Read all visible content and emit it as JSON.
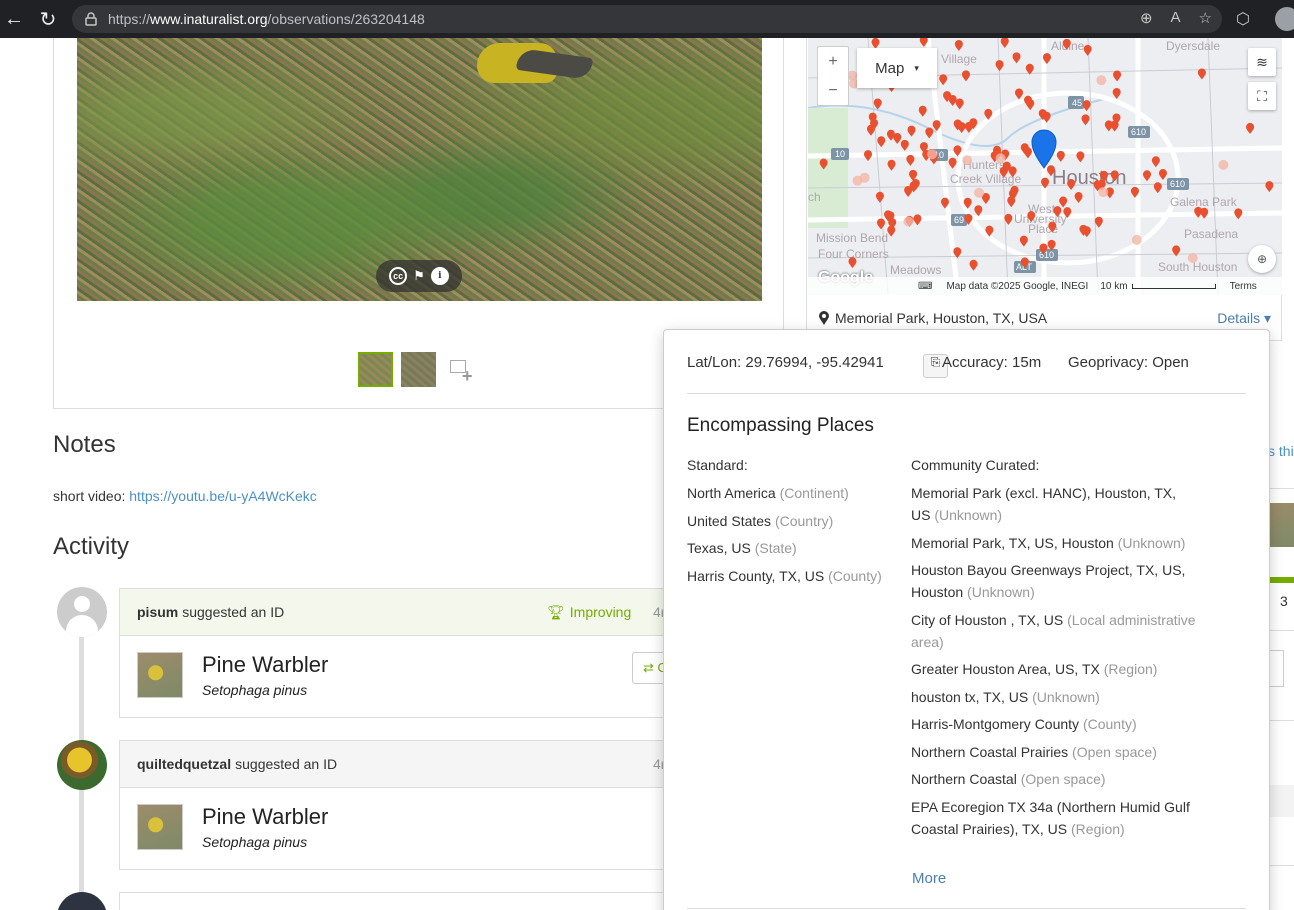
{
  "browser": {
    "url_prefix": "https://",
    "url_domain": "www.inaturalist.org",
    "url_path": "/observations/263204148"
  },
  "photo": {
    "thumbnail_count": 2
  },
  "map": {
    "type_label": "Map",
    "labels": {
      "aldine": "Aldine",
      "dyersdale": "Dyersdale",
      "village": "Village",
      "hunters": "Hunters",
      "creek_village": "Creek Village",
      "houston": "Houston",
      "galena_park": "Galena Park",
      "west": "West",
      "university": "University",
      "place": "Place",
      "mission_bend": "Mission Bend",
      "four_corners": "Four Corners",
      "meadows": "Meadows",
      "pasadena": "Pasadena",
      "south_houston": "South Houston",
      "ch": "ch",
      "hwy_10a": "10",
      "hwy_10b": "10",
      "hwy_45": "45",
      "hwy_610a": "610",
      "hwy_610b": "610",
      "hwy_610c": "610",
      "hwy_69": "69",
      "hwy_alt": "ALT"
    },
    "attribution": "Map data ©2025 Google, INEGI",
    "scale": "10 km",
    "terms": "Terms",
    "google": "Google",
    "place_name": "Memorial Park, Houston, TX, USA",
    "details_label": "Details"
  },
  "notes": {
    "heading": "Notes",
    "text": "short video: ",
    "link": "https://youtu.be/u-yA4WcKekc"
  },
  "activity": {
    "heading": "Activity",
    "items": [
      {
        "user": "pisum",
        "action": "suggested an ID",
        "badge": "Improving",
        "time": "4r",
        "taxon_common": "Pine Warbler",
        "taxon_scientific": "Setophaga pinus",
        "agree": "⇄ C"
      },
      {
        "user": "quiltedquetzal",
        "action": "suggested an ID",
        "time": "4r",
        "taxon_common": "Pine Warbler",
        "taxon_scientific": "Setophaga pinus"
      }
    ]
  },
  "right_column": {
    "fragment_text": "s thi",
    "number": "3"
  },
  "location_popover": {
    "latlon_label": "Lat/Lon: 29.76994, -95.42941",
    "accuracy": "Accuracy: 15m",
    "geoprivacy": "Geoprivacy: Open",
    "title": "Encompassing Places",
    "standard_title": "Standard:",
    "community_title": "Community Curated:",
    "standard": [
      {
        "name": "North America",
        "type": "(Continent)"
      },
      {
        "name": "United States",
        "type": "(Country)"
      },
      {
        "name": "Texas, US",
        "type": "(State)"
      },
      {
        "name": "Harris County, TX, US",
        "type": "(County)"
      }
    ],
    "community": [
      {
        "name": "Memorial Park (excl. HANC), Houston, TX, US",
        "type": "(Unknown)"
      },
      {
        "name": "Memorial Park, TX, US, Houston",
        "type": "(Unknown)"
      },
      {
        "name": "Houston Bayou Greenways Project, TX, US, Houston",
        "type": "(Unknown)"
      },
      {
        "name": "City of Houston , TX, US",
        "type": "(Local administrative area)"
      },
      {
        "name": "Greater Houston Area, US, TX",
        "type": "(Region)"
      },
      {
        "name": "houston tx, TX, US",
        "type": "(Unknown)"
      },
      {
        "name": "Harris-Montgomery County",
        "type": "(County)"
      },
      {
        "name": "Northern Coastal Prairies",
        "type": "(Open space)"
      },
      {
        "name": "Northern Coastal",
        "type": "(Open space)"
      },
      {
        "name": "EPA Ecoregion TX 34a (Northern Humid Gulf Coastal Prairies), TX, US",
        "type": "(Region)"
      }
    ],
    "more_label": "More"
  },
  "colors": {
    "brand_green": "#74ac00",
    "link_blue": "#4a90c2",
    "pin_red": "#e8502f",
    "pin_blue": "#1a73e8"
  }
}
